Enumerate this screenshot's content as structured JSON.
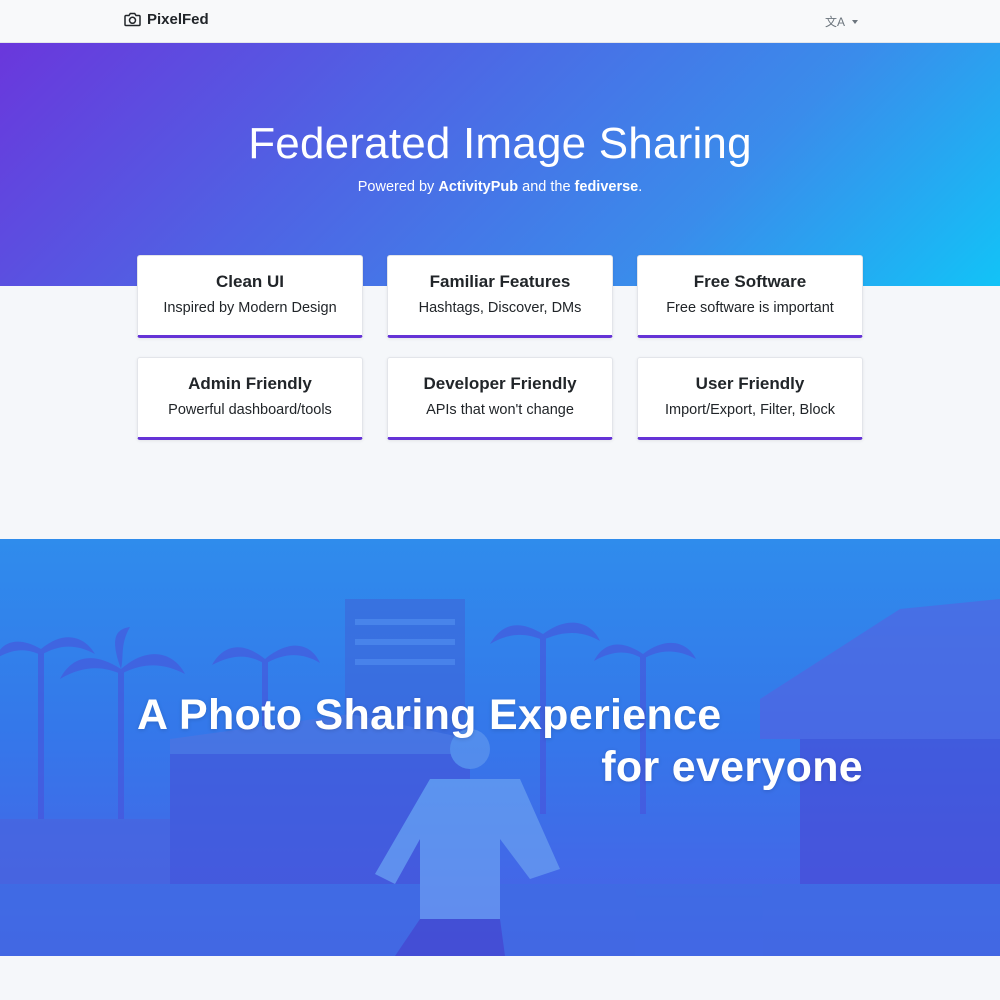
{
  "navbar": {
    "brand": "PixelFed",
    "brand_icon": "camera-icon",
    "language_label": "文A",
    "language_icon": "translate-icon"
  },
  "hero": {
    "title": "Federated Image Sharing",
    "subtitle_prefix": "Powered by ",
    "subtitle_activitypub": "ActivityPub",
    "subtitle_middle": " and the ",
    "subtitle_fediverse": "fediverse",
    "subtitle_suffix": "."
  },
  "features": [
    {
      "title": "Clean UI",
      "desc": "Inspired by Modern Design"
    },
    {
      "title": "Familiar Features",
      "desc": "Hashtags, Discover, DMs"
    },
    {
      "title": "Free Software",
      "desc": "Free software is important"
    },
    {
      "title": "Admin Friendly",
      "desc": "Powerful dashboard/tools"
    },
    {
      "title": "Developer Friendly",
      "desc": "APIs that won't change"
    },
    {
      "title": "User Friendly",
      "desc": "Import/Export, Filter, Block"
    }
  ],
  "banner": {
    "line1": "A Photo Sharing Experience",
    "line2": "for everyone"
  },
  "colors": {
    "accent": "#6533d6",
    "hero_start": "#6a37dc",
    "hero_end": "#12c3f7",
    "banner_tint": "#3478ea"
  }
}
